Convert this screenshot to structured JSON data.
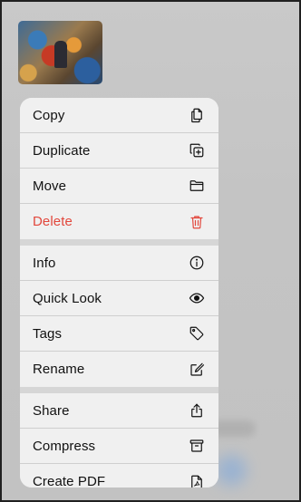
{
  "menu": {
    "sections": [
      {
        "items": [
          {
            "label": "Copy",
            "icon": "copy-icon",
            "destructive": false
          },
          {
            "label": "Duplicate",
            "icon": "duplicate-icon",
            "destructive": false
          },
          {
            "label": "Move",
            "icon": "folder-icon",
            "destructive": false
          },
          {
            "label": "Delete",
            "icon": "trash-icon",
            "destructive": true
          }
        ]
      },
      {
        "items": [
          {
            "label": "Info",
            "icon": "info-icon",
            "destructive": false
          },
          {
            "label": "Quick Look",
            "icon": "eye-icon",
            "destructive": false
          },
          {
            "label": "Tags",
            "icon": "tag-icon",
            "destructive": false
          },
          {
            "label": "Rename",
            "icon": "rename-icon",
            "destructive": false
          }
        ]
      },
      {
        "items": [
          {
            "label": "Share",
            "icon": "share-icon",
            "destructive": false
          },
          {
            "label": "Compress",
            "icon": "archive-icon",
            "destructive": false
          },
          {
            "label": "Create PDF",
            "icon": "pdf-icon",
            "destructive": false
          }
        ]
      }
    ]
  },
  "colors": {
    "destructive": "#e2473c",
    "menu_background": "#f0f0f0",
    "backdrop": "#c6c6c6"
  }
}
